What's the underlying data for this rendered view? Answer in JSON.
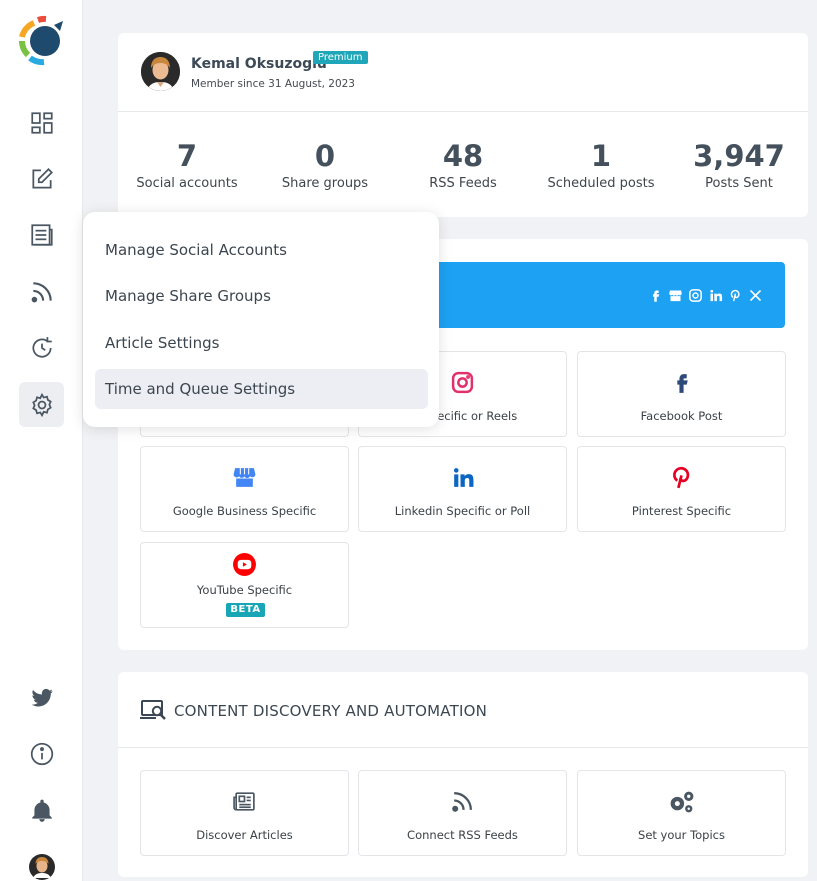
{
  "sidebar": {
    "items": [
      {
        "name": "dashboard"
      },
      {
        "name": "compose"
      },
      {
        "name": "articles"
      },
      {
        "name": "rss"
      },
      {
        "name": "queue"
      },
      {
        "name": "settings",
        "active": true
      }
    ],
    "bottom": [
      {
        "name": "twitter"
      },
      {
        "name": "info"
      },
      {
        "name": "notifications"
      },
      {
        "name": "profile"
      }
    ]
  },
  "profile": {
    "name": "Kemal Oksuzoglu",
    "badge": "Premium",
    "member_since": "Member since 31 August, 2023"
  },
  "stats": [
    {
      "value": "7",
      "label": "Social accounts"
    },
    {
      "value": "0",
      "label": "Share groups"
    },
    {
      "value": "48",
      "label": "RSS Feeds"
    },
    {
      "value": "1",
      "label": "Scheduled posts"
    },
    {
      "value": "3,947",
      "label": "Posts Sent"
    }
  ],
  "post_types": {
    "banner_icons": [
      "facebook-icon",
      "google-business-icon",
      "instagram-icon",
      "linkedin-icon",
      "pinterest-icon",
      "x-icon"
    ],
    "tiles": [
      {
        "label": ""
      },
      {
        "label": "m Specific or Reels"
      },
      {
        "label": "Facebook Post"
      },
      {
        "label": "Google Business Specific"
      },
      {
        "label": "Linkedin Specific or Poll"
      },
      {
        "label": "Pinterest Specific"
      },
      {
        "label": "YouTube Specific",
        "badge": "BETA"
      }
    ]
  },
  "discovery": {
    "title": "CONTENT DISCOVERY AND AUTOMATION",
    "tiles": [
      {
        "label": "Discover Articles"
      },
      {
        "label": "Connect RSS Feeds"
      },
      {
        "label": "Set your Topics"
      }
    ]
  },
  "settings_menu": {
    "items": [
      {
        "label": "Manage Social Accounts"
      },
      {
        "label": "Manage Share Groups"
      },
      {
        "label": "Article Settings"
      },
      {
        "label": "Time and Queue Settings",
        "active": true
      }
    ]
  },
  "colors": {
    "brand_blue": "#1da1f2",
    "badge_teal": "#1fa7b9",
    "instagram": "#e1306c",
    "facebook": "#2d4a7a",
    "google_business": "#4285f4",
    "linkedin": "#0a66c2",
    "pinterest": "#e60023",
    "youtube": "#ff0000"
  }
}
